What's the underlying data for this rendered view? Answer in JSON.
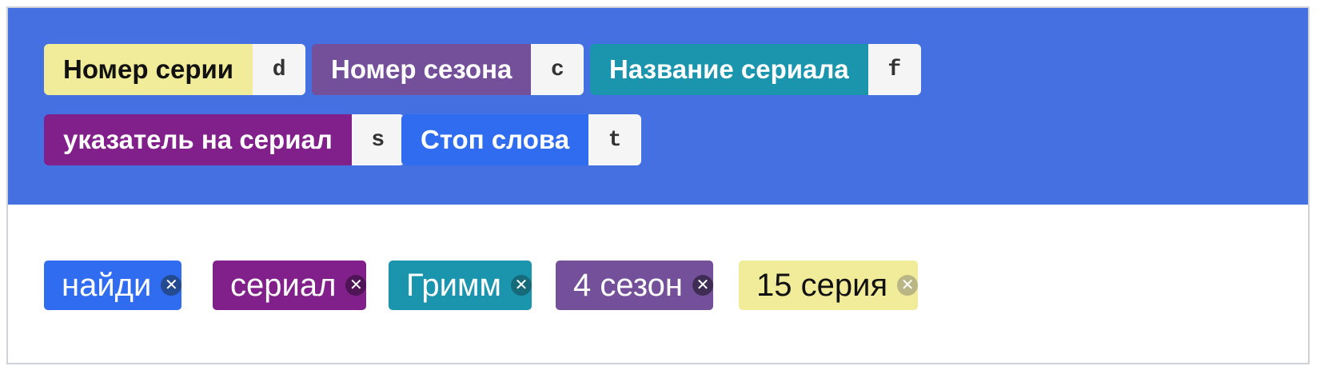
{
  "labels": [
    {
      "name": "Номер серии",
      "key": "d",
      "color": "#f1ec9a",
      "text_color": "#111111"
    },
    {
      "name": "Номер сезона",
      "key": "c",
      "color": "#74509b",
      "text_color": "#ffffff"
    },
    {
      "name": "Название сериала",
      "key": "f",
      "color": "#1a95ad",
      "text_color": "#ffffff"
    },
    {
      "name": "указатель на сериал",
      "key": "s",
      "color": "#82208b",
      "text_color": "#ffffff"
    },
    {
      "name": "Стоп слова",
      "key": "t",
      "color": "#2f6cf0",
      "text_color": "#ffffff"
    }
  ],
  "tokens": [
    {
      "text": "найди",
      "label": "Стоп слова",
      "color": "#2f6cf0",
      "text_color": "#ffffff"
    },
    {
      "text": "сериал",
      "label": "указатель на сериал",
      "color": "#82208b",
      "text_color": "#ffffff"
    },
    {
      "text": "Гримм",
      "label": "Название сериала",
      "color": "#1a95ad",
      "text_color": "#ffffff"
    },
    {
      "text": "4 сезон",
      "label": "Номер сезона",
      "color": "#74509b",
      "text_color": "#ffffff"
    },
    {
      "text": "15 серия",
      "label": "Номер серии",
      "color": "#f1ec9a",
      "text_color": "#111111"
    }
  ],
  "icons": {
    "remove": "close-icon"
  },
  "colors": {
    "toolbar_background": "#4570e1",
    "key_background": "#f5f5f5"
  }
}
